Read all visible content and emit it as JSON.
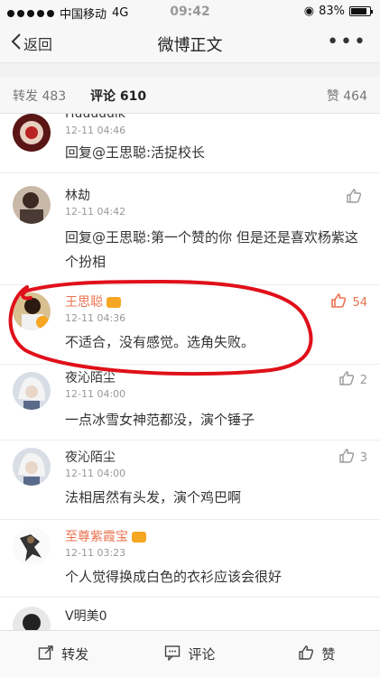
{
  "status_bar": {
    "carrier": "中国移动",
    "network": "4G",
    "time": "09:42",
    "battery": "83%",
    "battery_level": 0.83
  },
  "nav": {
    "back_label": "返回",
    "title": "微博正文",
    "more": "•••"
  },
  "tabs": {
    "repost": "转发 483",
    "comments": "评论 610",
    "likes": "赞 464"
  },
  "comments": [
    {
      "name": "Huuuuuik",
      "time": "12-11 04:46",
      "text": "回复@王思聪:活捉校长",
      "likes": ""
    },
    {
      "name": "林劫",
      "time": "12-11 04:42",
      "text": "回复@王思聪:第一个赞的你 但是还是喜欢杨紫这个扮相",
      "likes": ""
    },
    {
      "name": "王思聪",
      "time": "12-11 04:36",
      "text": "不适合，没有感觉。选角失败。",
      "likes": "54"
    },
    {
      "name": "夜沁陌尘",
      "time": "12-11 04:00",
      "text": "一点冰雪女神范都没，演个锤子",
      "likes": "2"
    },
    {
      "name": "夜沁陌尘",
      "time": "12-11 04:00",
      "text": "法相居然有头发，演个鸡巴啊",
      "likes": "3"
    },
    {
      "name": "至尊紫霞宝",
      "time": "12-11 03:23",
      "text": "个人觉得换成白色的衣衫应该会很好",
      "likes": ""
    },
    {
      "name": "V明美0",
      "time": "",
      "text": "",
      "likes": ""
    }
  ],
  "bottom_bar": {
    "repost": "转发",
    "comment": "评论",
    "like": "赞"
  },
  "colors": {
    "accent": "#ff8200",
    "vip_name": "#eb7350",
    "circle": "#e0101a"
  }
}
